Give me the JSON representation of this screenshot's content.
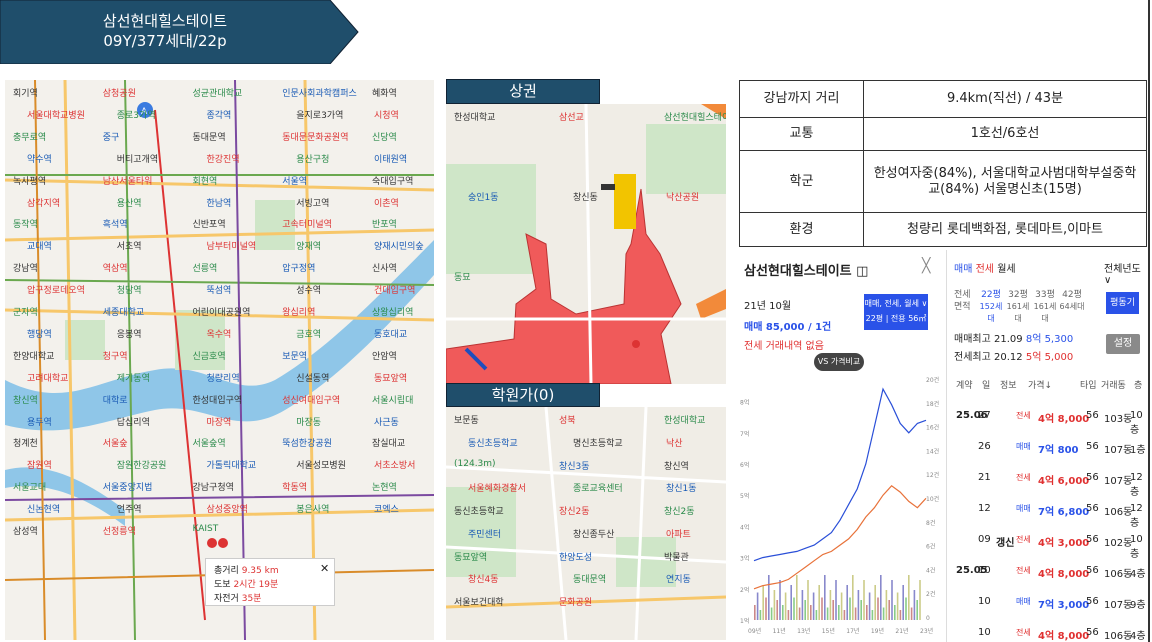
{
  "title": {
    "name": "삼선현대힐스테이트",
    "sub": "09Y/377세대/22p"
  },
  "route_map": {
    "labels": [
      "회기역",
      "삼청공원",
      "성균관대학교",
      "인문사회과학캠퍼스",
      "혜화역",
      "서울대학교병원",
      "종로3가역",
      "종각역",
      "을지로3가역",
      "시청역",
      "충무로역",
      "중구",
      "동대문역",
      "동대문문화공원역",
      "신당역",
      "약수역",
      "버티고개역",
      "한강진역",
      "용산구청",
      "이태원역",
      "녹사평역",
      "남산서울타워",
      "회현역",
      "서울역",
      "숙대입구역",
      "삼각지역",
      "용산역",
      "한남역",
      "서빙고역",
      "이촌역",
      "동작역",
      "흑석역",
      "신반포역",
      "고속터미널역",
      "반포역",
      "교대역",
      "서초역",
      "남부터미널역",
      "양재역",
      "양재시민의숲",
      "강남역",
      "역삼역",
      "선릉역",
      "압구정역",
      "신사역",
      "압구정로데오역",
      "청담역",
      "뚝섬역",
      "성수역",
      "건대입구역",
      "군자역",
      "세종대학교",
      "어린이대공원역",
      "왕십리역",
      "상왕십리역",
      "행당역",
      "응봉역",
      "옥수역",
      "금호역",
      "동호대교",
      "한양대학교",
      "청구역",
      "신금호역",
      "보문역",
      "안암역",
      "고려대학교",
      "제기동역",
      "청량리역",
      "신설동역",
      "동묘앞역",
      "창신역",
      "대학로",
      "한성대입구역",
      "성신여대입구역",
      "서울시립대",
      "용두역",
      "답십리역",
      "마장역",
      "마장동",
      "사근동",
      "청계천",
      "서울숲",
      "서울숲역",
      "뚝섬한강공원",
      "잠실대교",
      "잠원역",
      "잠원한강공원",
      "가톨릭대학교",
      "서울성모병원",
      "서초소방서",
      "서울교대",
      "서울중앙지법",
      "강남구청역",
      "학동역",
      "논현역",
      "신논현역",
      "언주역",
      "삼성중앙역",
      "봉은사역",
      "코엑스",
      "삼성역",
      "선정릉역",
      "KAIST"
    ],
    "popup": {
      "rows": [
        {
          "label": "총거리",
          "value": "9.35 km"
        },
        {
          "label": "도보",
          "value": "2시간 19분"
        },
        {
          "label": "자전거",
          "value": "35분"
        }
      ],
      "close": "✕"
    }
  },
  "sanggwon": {
    "header": "상권",
    "labels": [
      "한성대학교",
      "삼선교",
      "삼선현대힐스테이트",
      "숭인1동",
      "창신동",
      "낙산공원",
      "동묘"
    ]
  },
  "hakwon": {
    "header": "학원가(0)",
    "labels": [
      "보문동",
      "성북",
      "한성대학교",
      "동신초등학교",
      "명신초등학교",
      "낙산",
      "(124.3m)",
      "창신3동",
      "창신역",
      "서울혜화경찰서",
      "종로교육센터",
      "창신1동",
      "동신초등학교",
      "장신2동",
      "창신2동",
      "주민센터",
      "창신종두산",
      "아파트",
      "동묘앞역",
      "한양도성",
      "박물관",
      "창신4동",
      "동대문역",
      "연지동",
      "서울보건대학",
      "문화공원"
    ]
  },
  "info_table": [
    {
      "key": "강남까지 거리",
      "value": "9.4km(직선) / 43분"
    },
    {
      "key": "교통",
      "value": "1호선/6호선"
    },
    {
      "key": "학군",
      "value": "한성여자중(84%), 서울대학교사범대학부설중학교(84%) 서울명신초(15명)"
    },
    {
      "key": "환경",
      "value": "청량리 롯데백화점, 롯데마트,이마트"
    }
  ],
  "panel": {
    "title": "삼선현대힐스테이트",
    "title_icon": "◫",
    "close": "╳",
    "date": "21년 10월",
    "sale": "매매 85,000 / 1건",
    "lease": "전세 거래내역 없음",
    "filter_btn": "매매, 전세, 월세 ∨",
    "filter_size": "22평 | 전용 56㎡",
    "compare_btn": "VS 가격비교",
    "tabs": [
      "매매",
      "전세",
      "월세"
    ],
    "year_tab": "전체년도 ∨",
    "size_header": [
      "전세",
      "면적"
    ],
    "sizes": [
      {
        "p": "22평",
        "u": "152세대"
      },
      {
        "p": "32평",
        "u": "161세대"
      },
      {
        "p": "33평",
        "u": "161세대"
      },
      {
        "p": "42평",
        "u": "64세대"
      }
    ],
    "pyeong_btn": "평동기",
    "hi_sale": {
      "label": "매매최고",
      "date": "21.09",
      "price": "8억 5,300"
    },
    "hi_lease": {
      "label": "전세최고",
      "date": "20.12",
      "price": "5억 5,000"
    },
    "setting_btn": "설정",
    "cols": [
      "계약",
      "일",
      "정보",
      "가격↓",
      "타입",
      "거래동",
      "층"
    ],
    "rows": [
      {
        "ym": "25.06",
        "d": "27",
        "info": "",
        "type": "전세",
        "price": "4억 8,000",
        "sz": "56",
        "dong": "103동",
        "fl": "10층"
      },
      {
        "ym": "",
        "d": "26",
        "info": "",
        "type": "매매",
        "price": "7억 800",
        "sz": "56",
        "dong": "107동",
        "fl": "1층"
      },
      {
        "ym": "",
        "d": "21",
        "info": "",
        "type": "전세",
        "price": "4억 6,000",
        "sz": "56",
        "dong": "107동",
        "fl": "12층"
      },
      {
        "ym": "",
        "d": "12",
        "info": "",
        "type": "매매",
        "price": "7억 6,800",
        "sz": "56",
        "dong": "106동",
        "fl": "12층"
      },
      {
        "ym": "",
        "d": "09",
        "info": "갱신",
        "type": "전세",
        "price": "4억 3,000",
        "sz": "56",
        "dong": "102동",
        "fl": "10층"
      },
      {
        "ym": "25.05",
        "d": "10",
        "info": "",
        "type": "전세",
        "price": "4억 8,000",
        "sz": "56",
        "dong": "106동",
        "fl": "4층"
      },
      {
        "ym": "",
        "d": "10",
        "info": "",
        "type": "매매",
        "price": "7억 3,000",
        "sz": "56",
        "dong": "107동",
        "fl": "9층"
      },
      {
        "ym": "",
        "d": "10",
        "info": "",
        "type": "전세",
        "price": "4억 8,000",
        "sz": "56",
        "dong": "106동",
        "fl": "4층"
      }
    ]
  },
  "chart_data": {
    "type": "line",
    "x": [
      "09년",
      "11년",
      "13년",
      "15년",
      "17년",
      "19년",
      "21년",
      "23년"
    ],
    "y_left_ticks": [
      "8억",
      "7억",
      "6억",
      "5억",
      "4억",
      "3억",
      "2억",
      "1억"
    ],
    "y_right_ticks": [
      "20건",
      "18건",
      "16건",
      "14건",
      "12건",
      "10건",
      "8건",
      "6건",
      "4건",
      "2건",
      "0"
    ],
    "colors": {
      "sale": "#2a4fd8",
      "lease": "#e8723a"
    },
    "series": [
      {
        "values": [
          2.9,
          3.0,
          3.05,
          3.1,
          3.15,
          3.2,
          3.3,
          3.4,
          3.6,
          3.8,
          4.2,
          4.7,
          5.2,
          6.0,
          7.2,
          8.4,
          7.9,
          7.3,
          7.0,
          7.3,
          7.4
        ]
      },
      {
        "values": [
          2.0,
          2.1,
          2.15,
          2.2,
          2.3,
          2.5,
          2.7,
          2.9,
          3.1,
          3.2,
          3.4,
          3.6,
          3.9,
          4.3,
          4.6,
          5.0,
          5.3,
          5.1,
          4.8,
          4.6,
          4.9
        ]
      }
    ]
  },
  "colors": {
    "banner": "#1f4e6b",
    "sale": "#2a52e8",
    "lease": "#e03030"
  }
}
